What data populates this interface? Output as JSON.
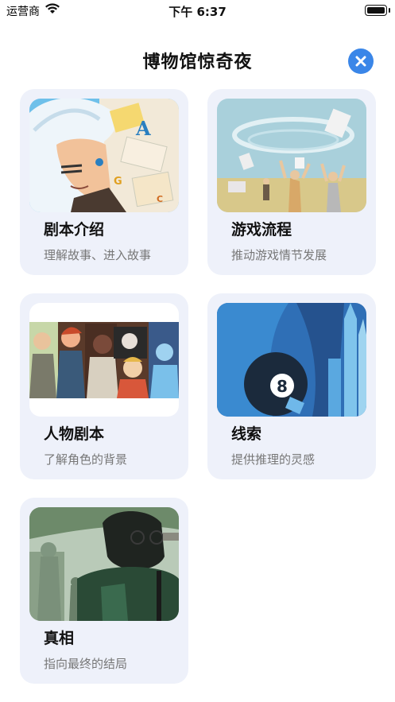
{
  "status_bar": {
    "carrier": "运营商",
    "time": "下午 6:37"
  },
  "header": {
    "title": "博物馆惊奇夜"
  },
  "cards": [
    {
      "name": "剧本介绍",
      "desc": "理解故事、进入故事"
    },
    {
      "name": "游戏流程",
      "desc": "推动游戏情节发展"
    },
    {
      "name": "人物剧本",
      "desc": "了解角色的背景"
    },
    {
      "name": "线索",
      "desc": "提供推理的灵感"
    },
    {
      "name": "真相",
      "desc": "指向最终的结局"
    }
  ],
  "artwork": {
    "card1_letters": [
      "A",
      "G",
      "C"
    ],
    "card4_ball_number": "8"
  },
  "colors": {
    "accent": "#3a86e8",
    "card_bg": "#eef1fa",
    "desc_text": "#777777"
  }
}
